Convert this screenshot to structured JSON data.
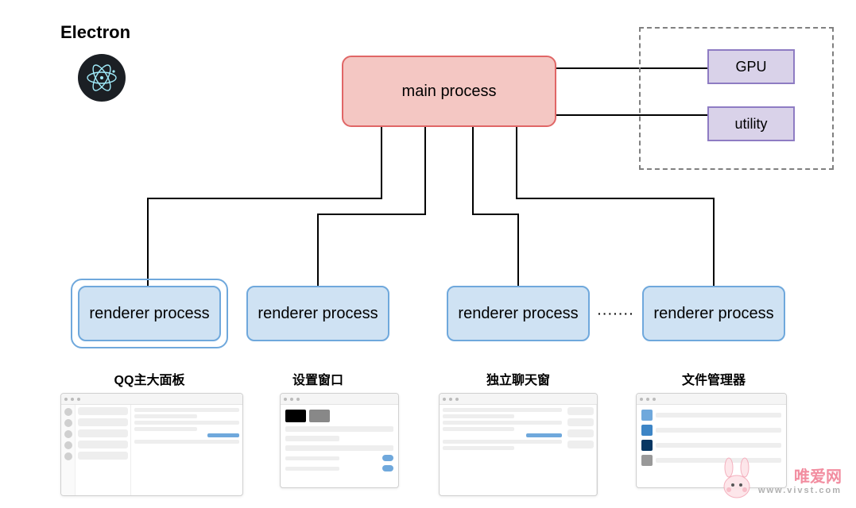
{
  "title": "Electron",
  "main_process": "main process",
  "aux": {
    "gpu": "GPU",
    "utility": "utility"
  },
  "renderers": {
    "label": "renderer process",
    "ellipsis": "·······",
    "items": [
      {
        "caption": "QQ主大面板"
      },
      {
        "caption": "设置窗口"
      },
      {
        "caption": "独立聊天窗"
      },
      {
        "caption": "文件管理器"
      }
    ]
  },
  "watermark": {
    "brand": "唯爱网",
    "url": "www.vivst.com"
  }
}
